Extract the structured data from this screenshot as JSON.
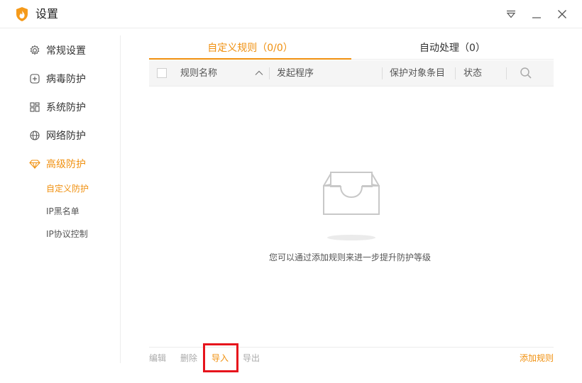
{
  "window": {
    "title": "设置",
    "accent_color": "#f0900f",
    "highlight_color": "#e6141c"
  },
  "sidebar": {
    "items": [
      {
        "label": "常规设置",
        "icon": "gear-icon"
      },
      {
        "label": "病毒防护",
        "icon": "plus-square-icon"
      },
      {
        "label": "系统防护",
        "icon": "grid-icon"
      },
      {
        "label": "网络防护",
        "icon": "globe-icon"
      },
      {
        "label": "高级防护",
        "icon": "diamond-icon"
      }
    ],
    "sub_items": [
      {
        "label": "自定义防护"
      },
      {
        "label": "IP黑名单"
      },
      {
        "label": "IP协议控制"
      }
    ]
  },
  "tabs": [
    {
      "label": "自定义规则（0/0）"
    },
    {
      "label": "自动处理（0）"
    }
  ],
  "table": {
    "columns": [
      "规则名称",
      "发起程序",
      "保护对象条目",
      "状态"
    ]
  },
  "empty_state": {
    "message": "您可以通过添加规则来进一步提升防护等级"
  },
  "footer": {
    "edit": "编辑",
    "delete": "删除",
    "import": "导入",
    "export": "导出",
    "add_rule": "添加规则"
  }
}
